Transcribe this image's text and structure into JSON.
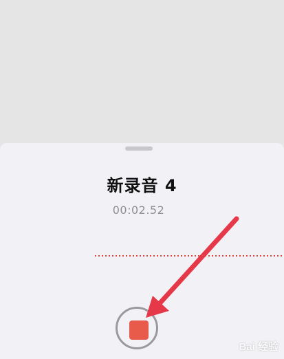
{
  "recording": {
    "title": "新录音 4",
    "elapsed_time": "00:02.52"
  },
  "controls": {
    "stop_icon": "stop-square-icon"
  },
  "annotation": {
    "arrow_icon": "arrow-icon",
    "arrow_color": "#e5394a"
  },
  "watermark": {
    "text": "Bai 经验"
  },
  "colors": {
    "accent_red": "#e85a4a",
    "waveform_red": "#e0453c",
    "sheet_bg": "#f2f2f6",
    "top_bg": "#e5e5e5"
  }
}
